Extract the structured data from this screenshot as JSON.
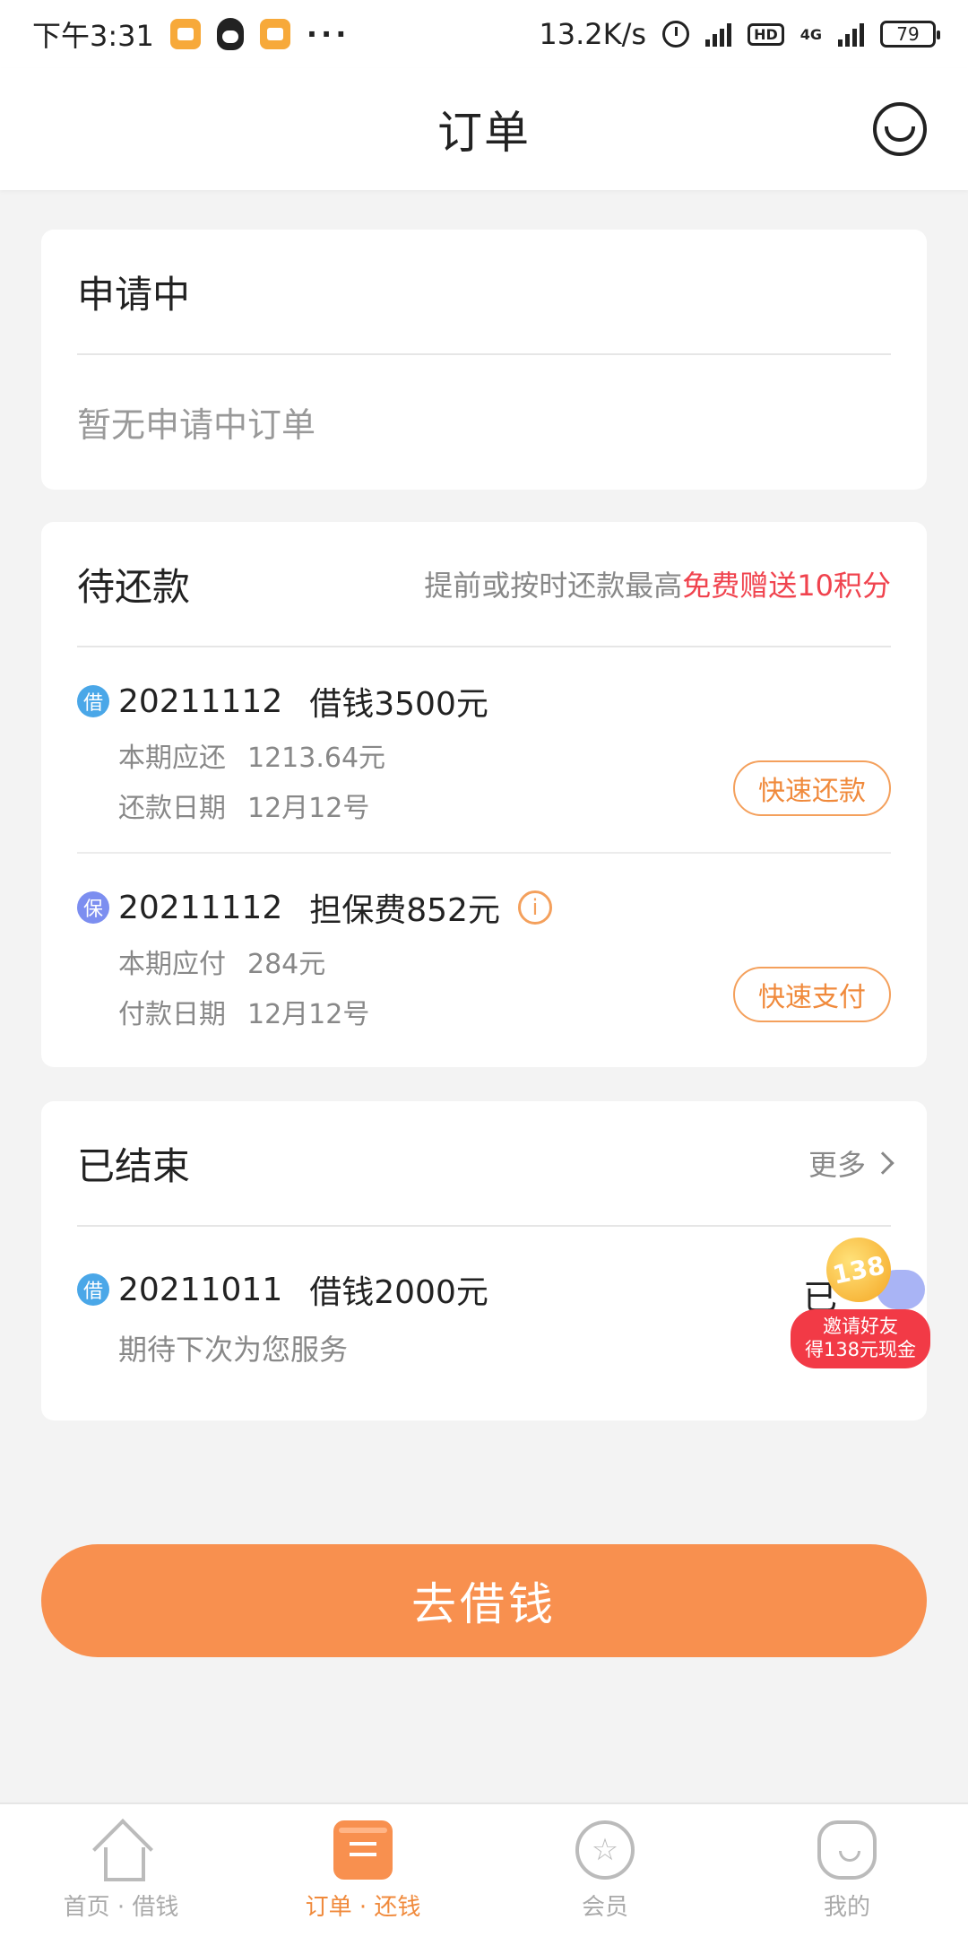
{
  "status_bar": {
    "time": "下午3:31",
    "more": "···",
    "net_speed": "13.2K/s",
    "hd": "HD",
    "network": "4G",
    "battery": "79"
  },
  "header": {
    "title": "订单"
  },
  "applying": {
    "title": "申请中",
    "empty": "暂无申请中订单"
  },
  "pending": {
    "title": "待还款",
    "promo_prefix": "提前或按时还款最高",
    "promo_highlight": "免费赠送10积分",
    "items": [
      {
        "badge": "借",
        "code": "20211112",
        "desc": "借钱3500元",
        "line1_label": "本期应还",
        "line1_value": "1213.64元",
        "line2_label": "还款日期",
        "line2_value": "12月12号",
        "action": "快速还款"
      },
      {
        "badge": "保",
        "code": "20211112",
        "desc": "担保费852元",
        "line1_label": "本期应付",
        "line1_value": "284元",
        "line2_label": "付款日期",
        "line2_value": "12月12号",
        "action": "快速支付"
      }
    ]
  },
  "finished": {
    "title": "已结束",
    "more": "更多",
    "items": [
      {
        "badge": "借",
        "code": "20211011",
        "desc": "借钱2000元",
        "note": "期待下次为您服务",
        "status_partial": "已"
      }
    ]
  },
  "invite": {
    "coin": "138",
    "line1": "邀请好友",
    "line2": "得138元现金"
  },
  "main_button": "去借钱",
  "bottom_nav": [
    {
      "label": "首页 · 借钱"
    },
    {
      "label": "订单 · 还钱"
    },
    {
      "label": "会员"
    },
    {
      "label": "我的"
    }
  ],
  "colors": {
    "accent": "#f8904f",
    "highlight": "#f0434e",
    "background": "#f3f3f3"
  }
}
